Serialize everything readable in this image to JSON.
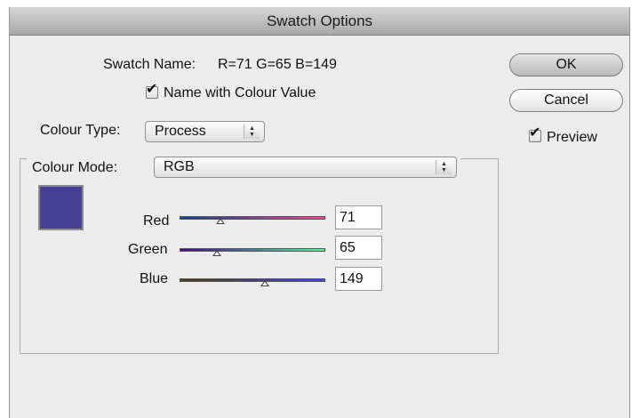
{
  "window": {
    "title": "Swatch Options"
  },
  "swatch_name": {
    "label": "Swatch Name:",
    "value": "R=71 G=65 B=149"
  },
  "name_with_colour_value": {
    "label": "Name with Colour Value",
    "checked": true
  },
  "colour_type": {
    "label": "Colour Type:",
    "selected": "Process"
  },
  "colour_mode": {
    "label": "Colour Mode:",
    "selected": "RGB"
  },
  "buttons": {
    "ok": "OK",
    "cancel": "Cancel"
  },
  "preview": {
    "label": "Preview",
    "checked": true
  },
  "swatch_color": "#473f95",
  "sliders": [
    {
      "label": "Red",
      "value": "71",
      "max": 255,
      "gradient": [
        "#004195",
        "#ff4195"
      ]
    },
    {
      "label": "Green",
      "value": "65",
      "max": 255,
      "gradient": [
        "#470095",
        "#47ff95"
      ]
    },
    {
      "label": "Blue",
      "value": "149",
      "max": 255,
      "gradient": [
        "#474100",
        "#4741ff"
      ]
    }
  ],
  "icons": {
    "check": "✔",
    "popup_arrows": "▲▼"
  }
}
